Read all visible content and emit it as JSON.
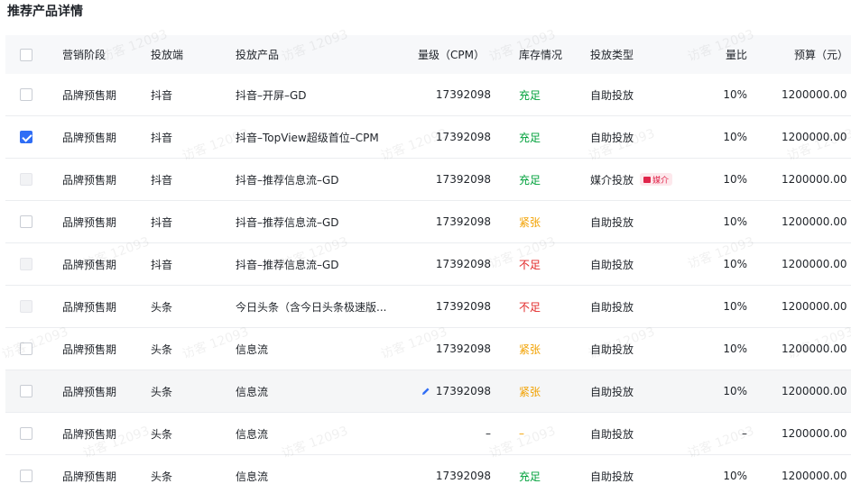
{
  "page_title": "推荐产品详情",
  "columns": {
    "stage": "营销阶段",
    "platform": "投放端",
    "product": "投放产品",
    "volume": "量级（CPM）",
    "inventory": "库存情况",
    "delivery_type": "投放类型",
    "ratio": "量比",
    "budget": "预算（元）"
  },
  "rows": [
    {
      "stage": "品牌预售期",
      "platform": "抖音",
      "product": "抖音–开屏–GD",
      "volume": "17392098",
      "inventory": "充足",
      "inventory_status": "ok",
      "delivery_type": "自助投放",
      "ratio": "10%",
      "budget": "1200000.00",
      "checkbox": "unchecked"
    },
    {
      "stage": "品牌预售期",
      "platform": "抖音",
      "product": "抖音–TopView超级首位–CPM",
      "volume": "17392098",
      "inventory": "充足",
      "inventory_status": "ok",
      "delivery_type": "自助投放",
      "ratio": "10%",
      "budget": "1200000.00",
      "checkbox": "checked"
    },
    {
      "stage": "品牌预售期",
      "platform": "抖音",
      "product": "抖音–推荐信息流–GD",
      "volume": "17392098",
      "inventory": "充足",
      "inventory_status": "ok",
      "delivery_type": "媒介投放",
      "tag": "媒介",
      "ratio": "10%",
      "budget": "1200000.00",
      "checkbox": "disabled"
    },
    {
      "stage": "品牌预售期",
      "platform": "抖音",
      "product": "抖音–推荐信息流–GD",
      "volume": "17392098",
      "inventory": "紧张",
      "inventory_status": "tight",
      "delivery_type": "自助投放",
      "ratio": "10%",
      "budget": "1200000.00",
      "checkbox": "unchecked"
    },
    {
      "stage": "品牌预售期",
      "platform": "抖音",
      "product": "抖音–推荐信息流–GD",
      "volume": "17392098",
      "inventory": "不足",
      "inventory_status": "short",
      "delivery_type": "自助投放",
      "ratio": "10%",
      "budget": "1200000.00",
      "checkbox": "disabled"
    },
    {
      "stage": "品牌预售期",
      "platform": "头条",
      "product": "今日头条（含今日头条极速版...",
      "volume": "17392098",
      "inventory": "不足",
      "inventory_status": "short",
      "delivery_type": "自助投放",
      "ratio": "10%",
      "budget": "1200000.00",
      "checkbox": "disabled"
    },
    {
      "stage": "品牌预售期",
      "platform": "头条",
      "product": "信息流",
      "volume": "17392098",
      "inventory": "紧张",
      "inventory_status": "tight",
      "delivery_type": "自助投放",
      "ratio": "10%",
      "budget": "1200000.00",
      "checkbox": "unchecked"
    },
    {
      "stage": "品牌预售期",
      "platform": "头条",
      "product": "信息流",
      "volume": "17392098",
      "inventory": "紧张",
      "inventory_status": "tight",
      "delivery_type": "自助投放",
      "ratio": "10%",
      "budget": "1200000.00",
      "checkbox": "unchecked",
      "editable": true,
      "hover": true
    },
    {
      "stage": "品牌预售期",
      "platform": "头条",
      "product": "信息流",
      "volume": "–",
      "inventory": "–",
      "inventory_status": "tight",
      "delivery_type": "自助投放",
      "ratio": "–",
      "budget": "1200000.00",
      "checkbox": "unchecked"
    },
    {
      "stage": "品牌预售期",
      "platform": "头条",
      "product": "信息流",
      "volume": "17392098",
      "inventory": "充足",
      "inventory_status": "ok",
      "delivery_type": "自助投放",
      "ratio": "10%",
      "budget": "1200000.00",
      "checkbox": "unchecked"
    }
  ],
  "watermark_text": "访客 12093",
  "colors": {
    "accent": "#2f6df5",
    "ok": "#00a13b",
    "tight": "#f2a100",
    "short": "#e22828",
    "tag_bg": "#fde8ec",
    "tag_fg": "#e0244a"
  },
  "icons": {
    "edit": "pencil-icon",
    "tag": "media-tag-icon"
  }
}
